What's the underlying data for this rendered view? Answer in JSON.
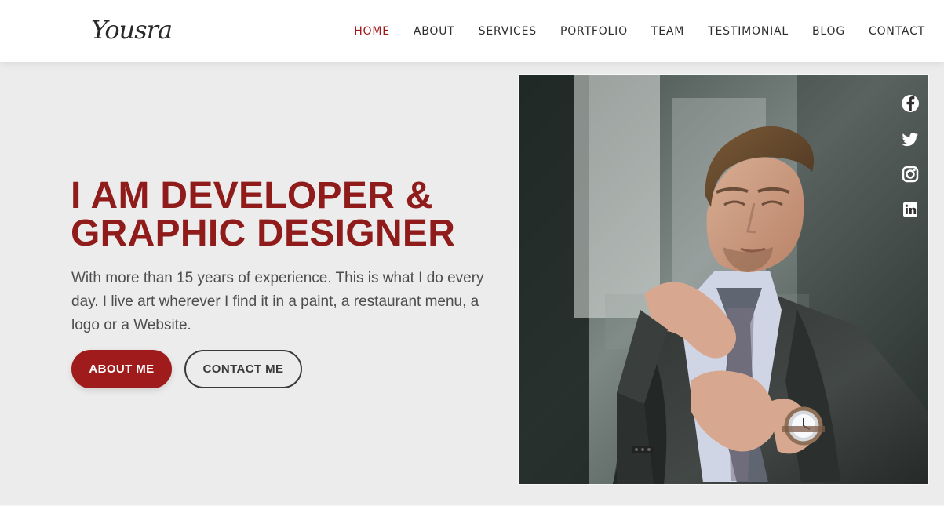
{
  "site": {
    "logo_text": "Yousra"
  },
  "nav": {
    "items": [
      {
        "label": "HOME",
        "active": true
      },
      {
        "label": "ABOUT",
        "active": false
      },
      {
        "label": "SERVICES",
        "active": false
      },
      {
        "label": "PORTFOLIO",
        "active": false
      },
      {
        "label": "TEAM",
        "active": false
      },
      {
        "label": "TESTIMONIAL",
        "active": false
      },
      {
        "label": "BLOG",
        "active": false
      },
      {
        "label": "CONTACT",
        "active": false
      }
    ]
  },
  "hero": {
    "title_line_1": "I AM DEVELOPER &",
    "title_line_2": "GRAPHIC DESIGNER",
    "description": "With more than 15 years of experience. This is what I do every day. I live art wherever I find it in a paint, a restaurant menu, a logo or a Website.",
    "primary_button": "ABOUT ME",
    "secondary_button": "CONTACT ME"
  },
  "social": {
    "icons": [
      "facebook-icon",
      "twitter-icon",
      "instagram-icon",
      "linkedin-icon"
    ]
  },
  "colors": {
    "accent": "#a01717",
    "title": "#8f1b1b",
    "background": "#ececec",
    "header": "#ffffff"
  }
}
